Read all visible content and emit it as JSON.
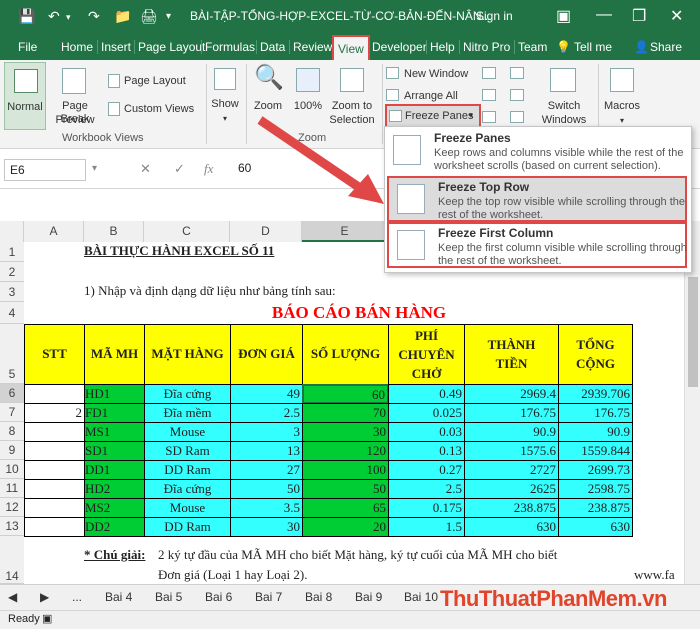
{
  "titlebar": {
    "title": "BÀI-TẬP-TỔNG-HỢP-EXCEL-TỪ-CƠ-BẢN-ĐẾN-NÂN...",
    "signin": "Sign in"
  },
  "tabs": [
    "File",
    "Home",
    "Insert",
    "Page Layout",
    "Formulas",
    "Data",
    "Review",
    "View",
    "Developer",
    "Help",
    "Nitro Pro",
    "Team",
    "Tell me",
    "Share"
  ],
  "ribbon": {
    "normal": "Normal",
    "page_break": "Page Break",
    "preview": "Preview",
    "page_layout": "Page Layout",
    "custom_views": "Custom Views",
    "workbook_views": "Workbook Views",
    "show": "Show",
    "zoom": "Zoom",
    "zoom100": "100%",
    "zoom_to": "Zoom to",
    "selection": "Selection",
    "zoom_group": "Zoom",
    "new_window": "New Window",
    "arrange_all": "Arrange All",
    "freeze_panes": "Freeze Panes",
    "switch": "Switch",
    "windows": "Windows",
    "macros": "Macros"
  },
  "freeze_menu": [
    {
      "title": "Freeze Panes",
      "desc": "Keep rows and columns visible while the rest of the worksheet scrolls (based on current selection)."
    },
    {
      "title": "Freeze Top Row",
      "desc": "Keep the top row visible while scrolling through the rest of the worksheet."
    },
    {
      "title": "Freeze First Column",
      "desc": "Keep the first column visible while scrolling through the rest of the worksheet."
    }
  ],
  "formula": {
    "namebox": "E6",
    "value": "60"
  },
  "columns": [
    "A",
    "B",
    "C",
    "D",
    "E"
  ],
  "sheet": {
    "title1": "BÀI THỰC HÀNH EXCEL SỐ 11",
    "instr": "1) Nhập và định dạng dữ liệu như bảng tính sau:",
    "report": "BÁO CÁO BÁN HÀNG",
    "headers": [
      "STT",
      "MÃ MH",
      "MẶT HÀNG",
      "ĐƠN GIÁ",
      "SỐ LƯỢNG",
      "PHÍ CHUYÊN CHỞ",
      "THÀNH TIỀN",
      "TỔNG CỘNG"
    ],
    "rows": [
      [
        "",
        "HD1",
        "Đĩa cứng",
        "49",
        "60",
        "0.49",
        "2969.4",
        "2939.706"
      ],
      [
        "2",
        "FD1",
        "Đĩa mềm",
        "2.5",
        "70",
        "0.025",
        "176.75",
        "176.75"
      ],
      [
        "",
        "MS1",
        "Mouse",
        "3",
        "30",
        "0.03",
        "90.9",
        "90.9"
      ],
      [
        "",
        "SD1",
        "SD Ram",
        "13",
        "120",
        "0.13",
        "1575.6",
        "1559.844"
      ],
      [
        "",
        "DD1",
        "DD Ram",
        "27",
        "100",
        "0.27",
        "2727",
        "2699.73"
      ],
      [
        "",
        "HD2",
        "Đĩa cứng",
        "50",
        "50",
        "2.5",
        "2625",
        "2598.75"
      ],
      [
        "",
        "MS2",
        "Mouse",
        "3.5",
        "65",
        "0.175",
        "238.875",
        "238.875"
      ],
      [
        "",
        "DD2",
        "DD Ram",
        "30",
        "20",
        "1.5",
        "630",
        "630"
      ]
    ],
    "note_label": "* Chú giải:",
    "note1": "2 ký tự đầu của MÃ MH cho biết Mặt hàng, ký tự cuối của MÃ MH cho biết",
    "note2": "Đơn giá (Loại 1 hay Loại 2).",
    "www": "www.fa"
  },
  "row_numbers": [
    "1",
    "2",
    "3",
    "4",
    "5",
    "6",
    "7",
    "8",
    "9",
    "10",
    "11",
    "12",
    "13",
    "14"
  ],
  "sheet_tabs": [
    "Bai 4",
    "Bai 5",
    "Bai 6",
    "Bai 7",
    "Bai 8",
    "Bai 9",
    "Bai 10"
  ],
  "status": {
    "ready": "Ready"
  },
  "watermark": "ThuThuatPhanMem.vn"
}
